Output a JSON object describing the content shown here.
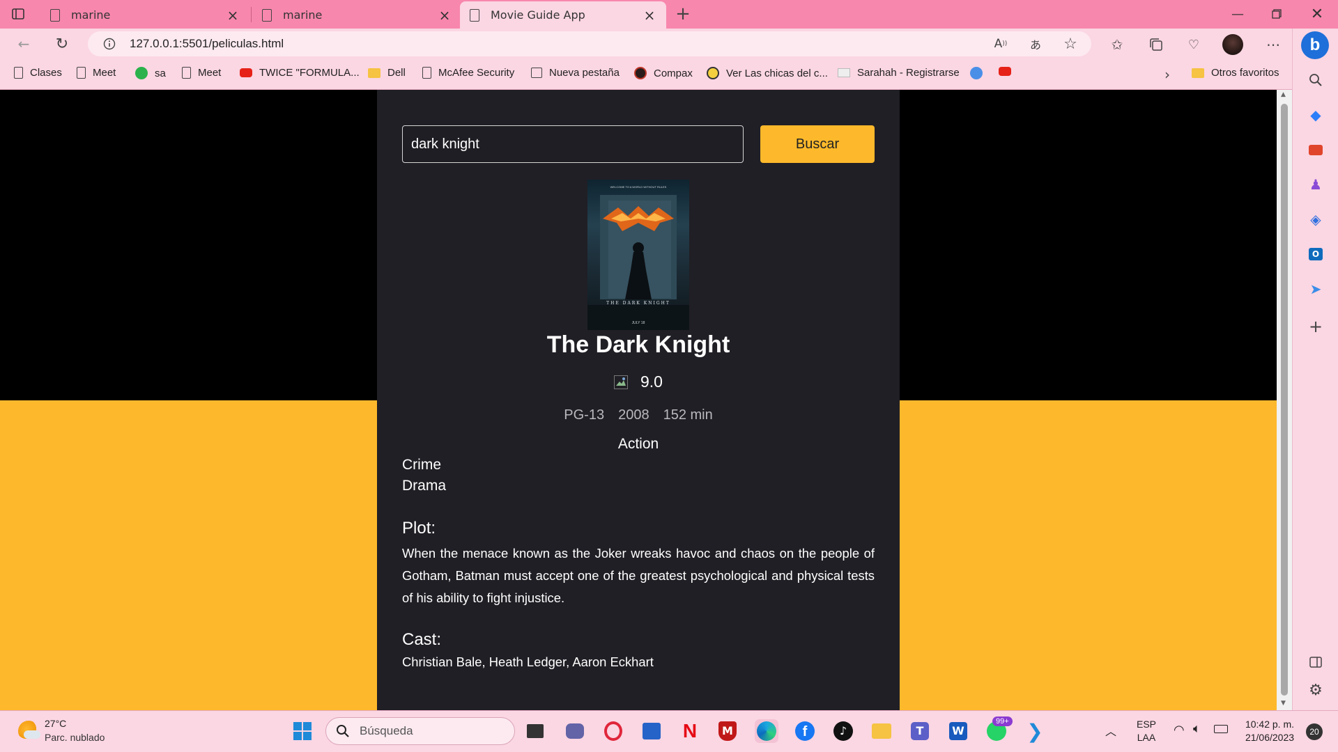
{
  "browser": {
    "tabs": [
      {
        "label": "marine"
      },
      {
        "label": "marine"
      },
      {
        "label": "Movie Guide App"
      }
    ],
    "url": "127.0.0.1:5501/peliculas.html",
    "bookmarks": [
      {
        "label": "Clases",
        "icon": "doc"
      },
      {
        "label": "Meet",
        "icon": "doc"
      },
      {
        "label": "sa",
        "icon": "circle-green"
      },
      {
        "label": "Meet",
        "icon": "doc"
      },
      {
        "label": "TWICE \"FORMULA...",
        "icon": "youtube"
      },
      {
        "label": "Dell",
        "icon": "folder"
      },
      {
        "label": "McAfee Security",
        "icon": "doc"
      },
      {
        "label": "Nueva pestaña",
        "icon": "calendar"
      },
      {
        "label": "Compax",
        "icon": "circle-dark"
      },
      {
        "label": "Ver Las chicas del c...",
        "icon": "circle-yellow"
      },
      {
        "label": "Sarahah - Registrarse",
        "icon": "envelope"
      }
    ],
    "other_favorites": "Otros favoritos"
  },
  "app": {
    "search_value": "dark knight",
    "search_button": "Buscar",
    "movie": {
      "title": "The Dark Knight",
      "rating": "9.0",
      "rated": "PG-13",
      "year": "2008",
      "runtime": "152 min",
      "genres": [
        "Action",
        "Crime",
        "Drama"
      ],
      "plot_heading": "Plot:",
      "plot": "When the menace known as the Joker wreaks havoc and chaos on the people of Gotham, Batman must accept one of the greatest psychological and physical tests of his ability to fight injustice.",
      "cast_heading": "Cast:",
      "cast": "Christian Bale, Heath Ledger, Aaron Eckhart",
      "poster_top_text": "WELCOME TO A WORLD WITHOUT RULES",
      "poster_title": "THE DARK KNIGHT",
      "poster_date": "JULY 18"
    }
  },
  "taskbar": {
    "weather_temp": "27°C",
    "weather_desc": "Parc. nublado",
    "search_placeholder": "Búsqueda",
    "whatsapp_badge": "99+",
    "lang_1": "ESP",
    "lang_2": "LAA",
    "time": "10:42 p. m.",
    "date": "21/06/2023",
    "notifications": "20"
  },
  "colors": {
    "accent_yellow": "#fdb92b",
    "card_bg": "#201f25",
    "browser_pink": "#f887ad"
  }
}
